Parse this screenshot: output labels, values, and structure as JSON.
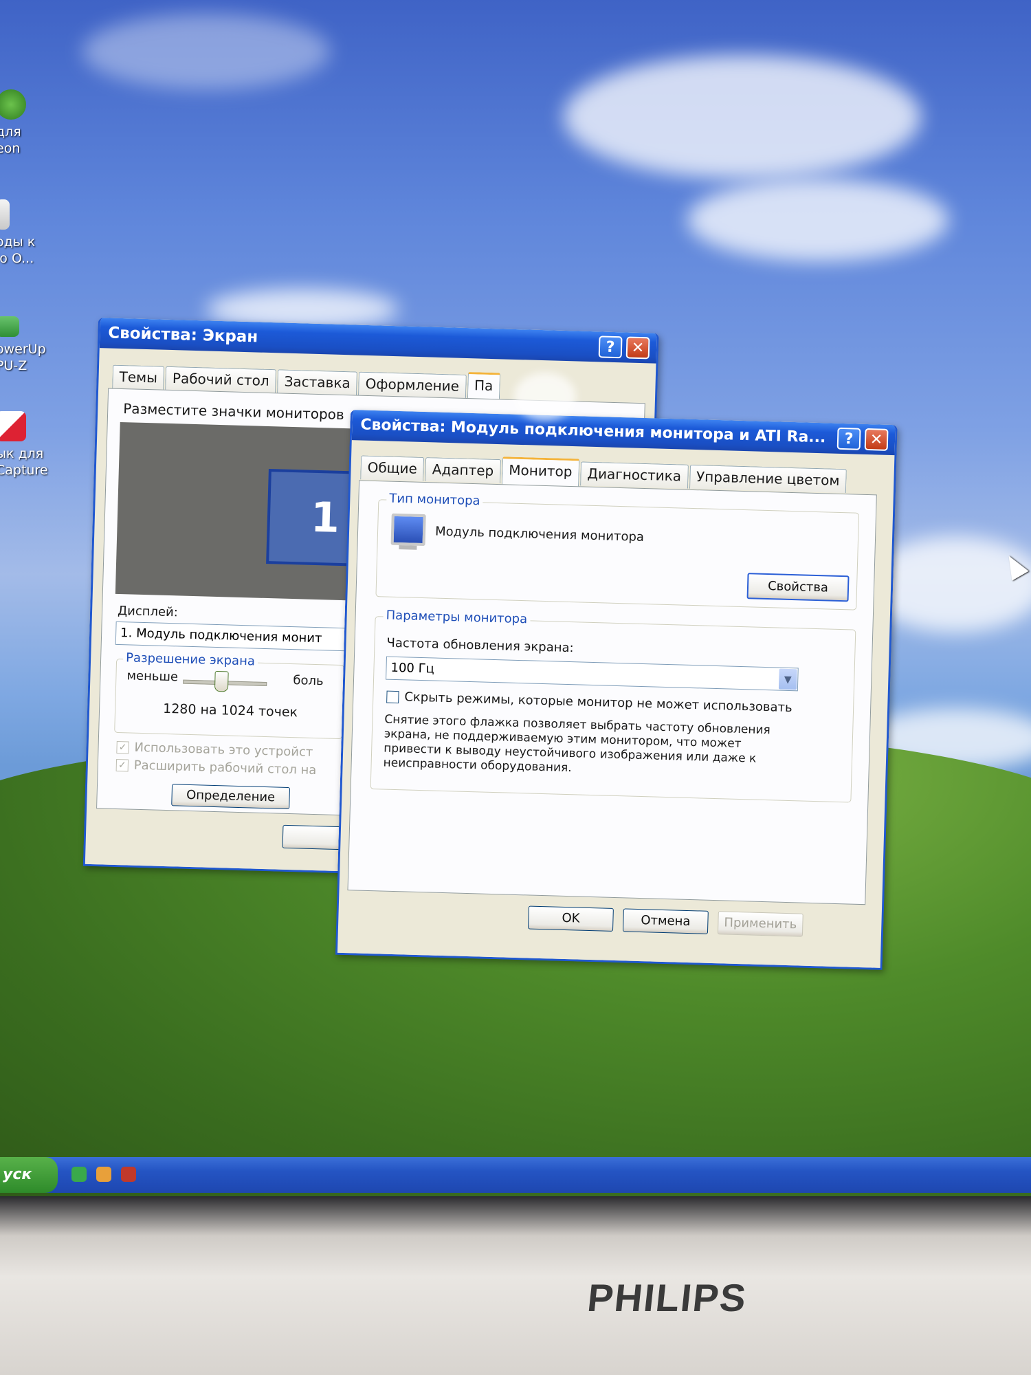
{
  "desktop": {
    "icons": [
      {
        "label": "для\neon"
      },
      {
        "label": "оды к\nlo O..."
      },
      {
        "label": "owerUp\nPU-Z"
      },
      {
        "label": "ык для\nCapture"
      }
    ]
  },
  "taskbar": {
    "start_label": "уск"
  },
  "bezel": {
    "brand": "PHILIPS"
  },
  "display_window": {
    "title": "Свойства: Экран",
    "tabs": [
      "Темы",
      "Рабочий стол",
      "Заставка",
      "Оформление",
      "Па"
    ],
    "arrange_label": "Разместите значки мониторов",
    "monitor_number": "1",
    "display_label": "Дисплей:",
    "display_value": "1. Модуль подключения монит",
    "resolution_group": "Разрешение экрана",
    "less_label": "меньше",
    "more_label": "боль",
    "resolution_value": "1280 на 1024 точек",
    "check_primary": "Использовать это устройст",
    "check_extend": "Расширить рабочий стол на",
    "identify_button": "Определение"
  },
  "monitor_window": {
    "title": "Свойства: Модуль подключения монитора и ATI Ra...",
    "help": "?",
    "close": "✕",
    "tabs": [
      "Общие",
      "Адаптер",
      "Монитор",
      "Диагностика",
      "Управление цветом"
    ],
    "active_tab": "Монитор",
    "monitor_type_group": "Тип монитора",
    "monitor_name": "Модуль подключения монитора",
    "properties_button": "Свойства",
    "monitor_params_group": "Параметры монитора",
    "refresh_label": "Частота обновления экрана:",
    "refresh_value": "100 Гц",
    "hide_modes_label": "Скрыть режимы, которые монитор не может использовать",
    "hide_modes_checked": false,
    "warning_lines": [
      "Снятие этого флажка позволяет выбрать частоту обновления",
      "экрана, не поддерживаемую этим монитором, что может",
      "привести к выводу неустойчивого изображения или даже к",
      "неисправности оборудования."
    ],
    "ok_button": "OK",
    "cancel_button": "Отмена",
    "apply_button": "Применить"
  },
  "colors": {
    "xp_title_blue": "#1c5ad8",
    "group_title_blue": "#1f4fb8",
    "close_red": "#c23b16",
    "dialog_face": "#ece9d8"
  }
}
